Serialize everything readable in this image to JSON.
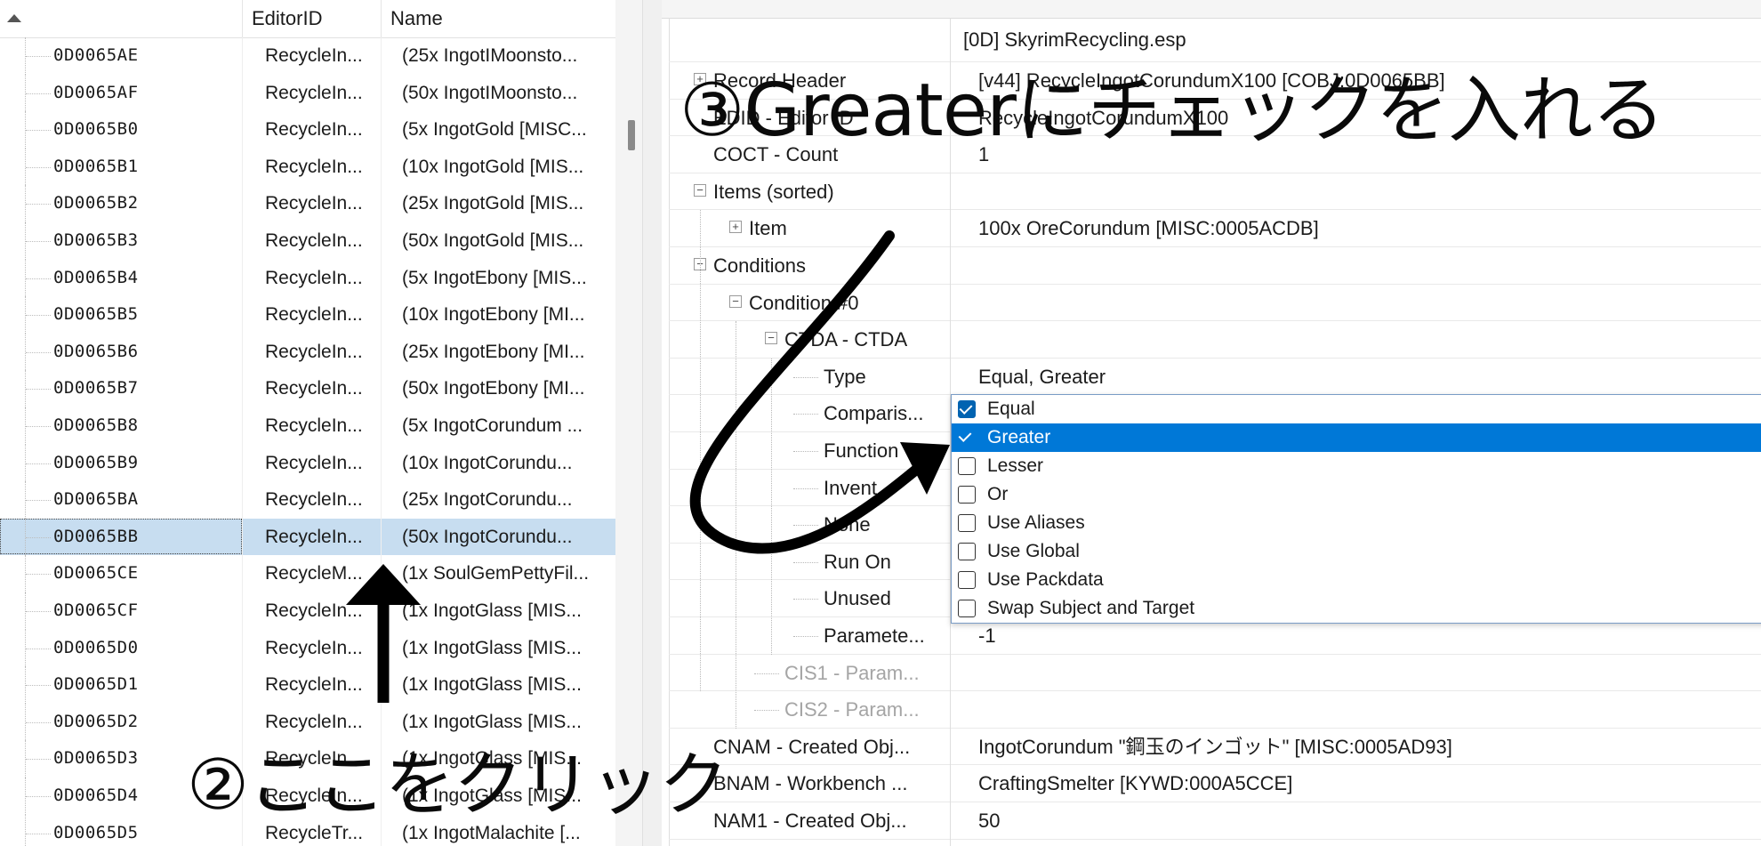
{
  "left_header": {
    "col_editorid": "EditorID",
    "col_name": "Name"
  },
  "left_rows": [
    {
      "formid": "0D0065AE",
      "editorid": "RecycleIn...",
      "name": "(25x IngotIMoonsto..."
    },
    {
      "formid": "0D0065AF",
      "editorid": "RecycleIn...",
      "name": "(50x IngotIMoonsto..."
    },
    {
      "formid": "0D0065B0",
      "editorid": "RecycleIn...",
      "name": "(5x IngotGold [MISC..."
    },
    {
      "formid": "0D0065B1",
      "editorid": "RecycleIn...",
      "name": "(10x IngotGold [MIS..."
    },
    {
      "formid": "0D0065B2",
      "editorid": "RecycleIn...",
      "name": "(25x IngotGold [MIS..."
    },
    {
      "formid": "0D0065B3",
      "editorid": "RecycleIn...",
      "name": "(50x IngotGold [MIS..."
    },
    {
      "formid": "0D0065B4",
      "editorid": "RecycleIn...",
      "name": "(5x IngotEbony [MIS..."
    },
    {
      "formid": "0D0065B5",
      "editorid": "RecycleIn...",
      "name": "(10x IngotEbony [MI..."
    },
    {
      "formid": "0D0065B6",
      "editorid": "RecycleIn...",
      "name": "(25x IngotEbony [MI..."
    },
    {
      "formid": "0D0065B7",
      "editorid": "RecycleIn...",
      "name": "(50x IngotEbony [MI..."
    },
    {
      "formid": "0D0065B8",
      "editorid": "RecycleIn...",
      "name": "(5x IngotCorundum ..."
    },
    {
      "formid": "0D0065B9",
      "editorid": "RecycleIn...",
      "name": "(10x IngotCorundu..."
    },
    {
      "formid": "0D0065BA",
      "editorid": "RecycleIn...",
      "name": "(25x IngotCorundu..."
    },
    {
      "formid": "0D0065BB",
      "editorid": "RecycleIn...",
      "name": "(50x IngotCorundu...",
      "selected": true
    },
    {
      "formid": "0D0065CE",
      "editorid": "RecycleM...",
      "name": "(1x SoulGemPettyFil..."
    },
    {
      "formid": "0D0065CF",
      "editorid": "RecycleIn...",
      "name": "(1x IngotGlass [MIS..."
    },
    {
      "formid": "0D0065D0",
      "editorid": "RecycleIn...",
      "name": "(1x IngotGlass [MIS..."
    },
    {
      "formid": "0D0065D1",
      "editorid": "RecycleIn...",
      "name": "(1x IngotGlass [MIS..."
    },
    {
      "formid": "0D0065D2",
      "editorid": "RecycleIn...",
      "name": "(1x IngotGlass [MIS..."
    },
    {
      "formid": "0D0065D3",
      "editorid": "RecycleIn...",
      "name": "(1x IngotGlass [MIS..."
    },
    {
      "formid": "0D0065D4",
      "editorid": "RecycleIn...",
      "name": "(1x IngotGlass [MIS..."
    },
    {
      "formid": "0D0065D5",
      "editorid": "RecycleTr...",
      "name": "(1x IngotMalachite [..."
    }
  ],
  "right_header": "[0D] SkyrimRecycling.esp",
  "record_rows": [
    {
      "label": "Record Header",
      "value": "[v44] RecycleIngotCorundumX100 [COBJ:0D0065BB]",
      "indent": 0,
      "expander": "plus"
    },
    {
      "label": "EDID - Editor ID",
      "value": "RecycleIngotCorundumX100",
      "indent": 0
    },
    {
      "label": "COCT - Count",
      "value": "1",
      "indent": 0
    },
    {
      "label": "Items (sorted)",
      "value": "",
      "indent": 0,
      "expander": "minus"
    },
    {
      "label": "Item",
      "value": "100x OreCorundum [MISC:0005ACDB]",
      "indent": 1,
      "expander": "plus"
    },
    {
      "label": "Conditions",
      "value": "",
      "indent": 0,
      "expander": "minus"
    },
    {
      "label": "Condition #0",
      "value": "",
      "indent": 1,
      "expander": "minus"
    },
    {
      "label": "CTDA - CTDA",
      "value": "",
      "indent": 2,
      "expander": "minus"
    },
    {
      "label": "Type",
      "value": "Equal, Greater",
      "indent": 3
    },
    {
      "label": "Comparis...",
      "value": "",
      "indent": 3
    },
    {
      "label": "Function",
      "value": "",
      "indent": 3
    },
    {
      "label": "Invent...",
      "value": "",
      "indent": 3
    },
    {
      "label": "None",
      "value": "",
      "indent": 3
    },
    {
      "label": "Run On",
      "value": "",
      "indent": 3
    },
    {
      "label": "Unused",
      "value": "",
      "indent": 3
    },
    {
      "label": "Paramete...",
      "value": "-1",
      "indent": 3
    },
    {
      "label": "CIS1 - Param...",
      "value": "",
      "indent": 2,
      "dim": true
    },
    {
      "label": "CIS2 - Param...",
      "value": "",
      "indent": 2,
      "dim": true
    },
    {
      "label": "CNAM - Created Obj...",
      "value": "IngotCorundum \"鋼玉のインゴット\" [MISC:0005AD93]",
      "indent": 0
    },
    {
      "label": "BNAM - Workbench ...",
      "value": "CraftingSmelter [KYWD:000A5CCE]",
      "indent": 0
    },
    {
      "label": "NAM1 - Created Obj...",
      "value": "50",
      "indent": 0
    }
  ],
  "type_dropdown": [
    {
      "label": "Equal",
      "checked": true
    },
    {
      "label": "Greater",
      "checked": true,
      "highlighted": true
    },
    {
      "label": "Lesser",
      "checked": false
    },
    {
      "label": "Or",
      "checked": false
    },
    {
      "label": "Use Aliases",
      "checked": false
    },
    {
      "label": "Use Global",
      "checked": false
    },
    {
      "label": "Use Packdata",
      "checked": false
    },
    {
      "label": "Swap Subject and Target",
      "checked": false
    }
  ],
  "annotations": {
    "step2": "②ここをクリック",
    "step3": "③Greaterにチェックを入れる"
  },
  "colors": {
    "selection": "#c7ddf0",
    "highlight": "#0078d7",
    "checkbox": "#0063b1"
  }
}
